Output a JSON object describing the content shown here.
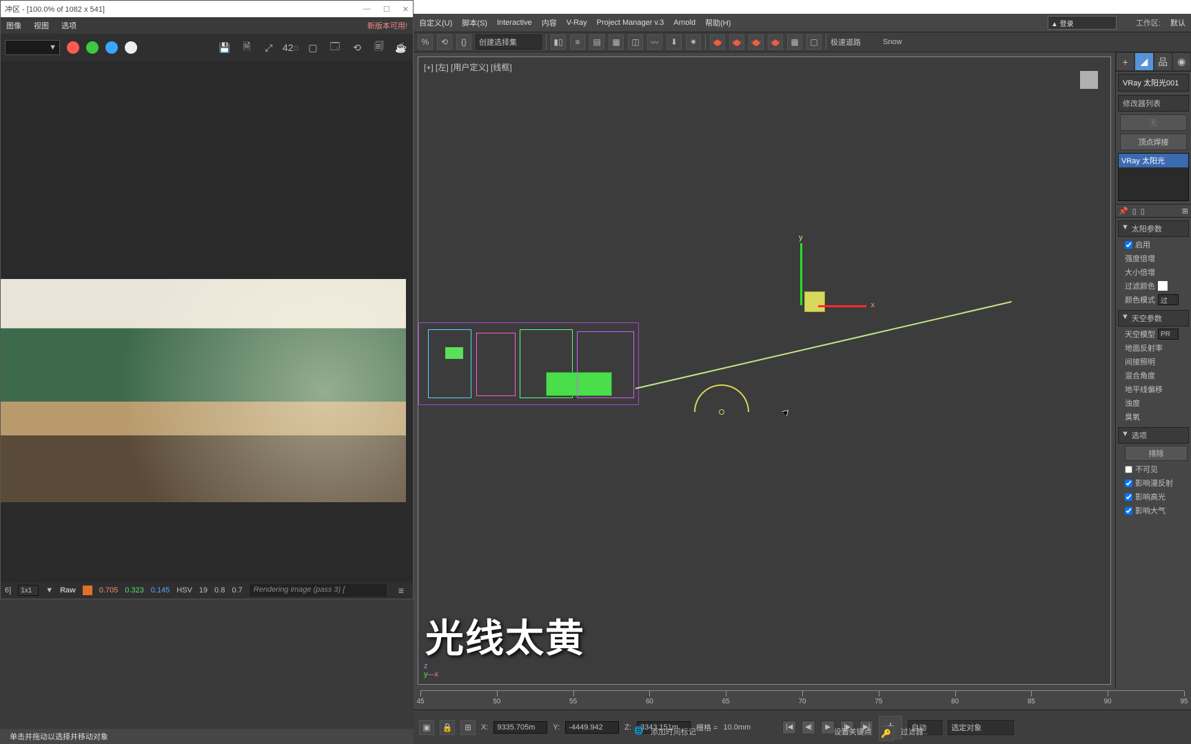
{
  "vfb": {
    "title": "冲区 - [100.0% of 1082 x 541]",
    "win_ctrls": [
      "—",
      "☐",
      "✕"
    ],
    "menu": [
      "图像",
      "视图",
      "选项"
    ],
    "newver": "新版本可用!",
    "tools_right": [
      "💾",
      "🗎",
      "⤢",
      "42◌",
      "▢",
      "🗔",
      "⟲",
      "🗐",
      "☕"
    ],
    "status": {
      "crop": "6]",
      "scale": "1x1",
      "down": "▼",
      "raw": "Raw",
      "r": "0.705",
      "g": "0.323",
      "b": "0.145",
      "hsv": "HSV",
      "h": "19",
      "s": "0.8",
      "v": "0.7",
      "prog": "Rendering image (pass 3) ["
    }
  },
  "tip": "单击并拖动以选择并移动对象",
  "max": {
    "menu": [
      "自定义(U)",
      "脚本(S)",
      "Interactive",
      "内容",
      "V-Ray",
      "Project Manager v.3",
      "Arnold",
      "帮助(H)"
    ],
    "login": "▲ 登录",
    "workspace_lbl": "工作区:",
    "workspace": "默认",
    "selset": "创建选择集",
    "toolbar_right": [
      "极速道路",
      "Snow"
    ],
    "viewport_label": "[+] [左]  [用户定义]  [线框]",
    "coords": {
      "x_lbl": "X:",
      "x": "9335.705m",
      "y_lbl": "Y:",
      "y": "-4449.942",
      "z_lbl": "Z:",
      "z": "3343.151m",
      "grid_lbl": "栅格 =",
      "grid": "10.0mm"
    },
    "playback": [
      "|◀",
      "◀|",
      "▶",
      "|▶",
      "▶|"
    ],
    "auto": "自动",
    "selobj": "选定对象",
    "addtime": "添加时间标记",
    "setkey": "设置关键点",
    "filter": "过滤器..",
    "ticks": [
      45,
      50,
      55,
      60,
      65,
      70,
      75,
      80,
      85,
      90,
      95
    ]
  },
  "cmd": {
    "obj": "VRay 太阳光001",
    "modlist_hdr": "修改器列表",
    "mod_none": "无",
    "vertex_weld": "顶点焊接",
    "stack_sel": "VRay 太阳光",
    "roll_sun": "太阳参数",
    "sun": {
      "enable": "启用",
      "intensity": "强度倍增",
      "size": "大小倍增",
      "filter": "过滤颜色",
      "colormode": "颜色模式",
      "colormode_val": "过"
    },
    "roll_sky": "天空参数",
    "sky": {
      "model": "天空模型",
      "model_val": "PR",
      "ground": "地面反射率",
      "indirect": "间接照明",
      "blend": "混合角度",
      "horizon": "地平线偏移",
      "turbidity": "浊度",
      "ozone": "臭氧"
    },
    "roll_opt": "选项",
    "opt": {
      "exclude": "排除",
      "invisible": "不可见",
      "diffuse": "影响漫反射",
      "specular": "影响高光",
      "atmos": "影响大气"
    }
  },
  "subtitle": "光线太黄"
}
